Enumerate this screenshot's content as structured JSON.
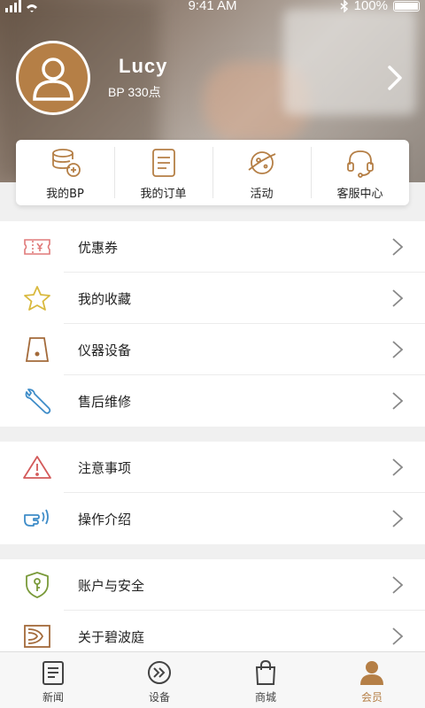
{
  "status_bar": {
    "time": "9:41 AM",
    "battery": "100%"
  },
  "profile": {
    "name": "Lucy",
    "points": "BP 330点"
  },
  "quick_actions": [
    {
      "label": "我的BP",
      "icon": "coins-icon"
    },
    {
      "label": "我的订单",
      "icon": "order-list-icon"
    },
    {
      "label": "活动",
      "icon": "planet-icon"
    },
    {
      "label": "客服中心",
      "icon": "headset-icon"
    }
  ],
  "menu_groups": [
    [
      {
        "label": "优惠券",
        "icon": "coupon-icon"
      },
      {
        "label": "我的收藏",
        "icon": "star-icon"
      },
      {
        "label": "仪器设备",
        "icon": "device-icon"
      },
      {
        "label": "售后维修",
        "icon": "wrench-icon"
      }
    ],
    [
      {
        "label": "注意事项",
        "icon": "warning-icon"
      },
      {
        "label": "操作介绍",
        "icon": "hand-gesture-icon"
      }
    ],
    [
      {
        "label": "账户与安全",
        "icon": "shield-key-icon"
      },
      {
        "label": "关于碧波庭",
        "icon": "brand-logo-icon"
      }
    ]
  ],
  "tabs": [
    {
      "label": "新闻",
      "icon": "news-icon",
      "active": false
    },
    {
      "label": "设备",
      "icon": "device-circle-icon",
      "active": false
    },
    {
      "label": "商城",
      "icon": "shopping-bag-icon",
      "active": false
    },
    {
      "label": "会员",
      "icon": "member-icon",
      "active": true
    }
  ],
  "colors": {
    "accent": "#b57f46",
    "arrow": "#888888"
  }
}
